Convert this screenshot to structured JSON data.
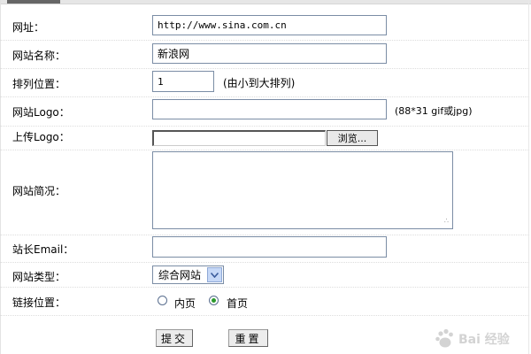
{
  "form": {
    "url": {
      "label": "网址：",
      "value": "http://www.sina.com.cn"
    },
    "site_name": {
      "label": "网站名称：",
      "value": "新浪网"
    },
    "order": {
      "label": "排列位置：",
      "value": "1",
      "hint": "(由小到大排列)"
    },
    "logo_url": {
      "label": "网站Logo：",
      "value": "",
      "hint": "(88*31 gif或jpg)"
    },
    "upload_logo": {
      "label": "上传Logo：",
      "browse_label": "浏览..."
    },
    "description": {
      "label": "网站简况：",
      "value": ""
    },
    "owner_email": {
      "label": "站长Email：",
      "value": ""
    },
    "site_type": {
      "label": "网站类型：",
      "selected": "综合网站"
    },
    "link_position": {
      "label": "链接位置：",
      "options": [
        {
          "label": "内页",
          "checked": false
        },
        {
          "label": "首页",
          "checked": true
        }
      ]
    },
    "submit_label": "提交",
    "reset_label": "重置"
  },
  "watermark": {
    "text": "Bai 经验",
    "icon": "baidu-paw-icon"
  },
  "colors": {
    "field_border": "#7b8da5",
    "radio_checked": "#2b9a2b",
    "select_arrow_bg": "#c6d8f7"
  }
}
